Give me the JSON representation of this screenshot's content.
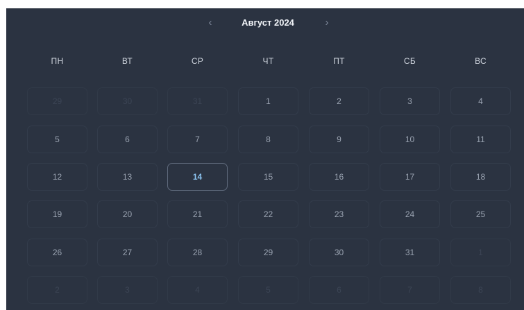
{
  "header": {
    "prev_icon": "‹",
    "next_icon": "›",
    "title": "Август 2024"
  },
  "weekdays": [
    "ПН",
    "ВТ",
    "СР",
    "ЧТ",
    "ПТ",
    "СБ",
    "ВС"
  ],
  "weeks": [
    [
      {
        "d": "29",
        "muted": true
      },
      {
        "d": "30",
        "muted": true
      },
      {
        "d": "31",
        "muted": true
      },
      {
        "d": "1"
      },
      {
        "d": "2"
      },
      {
        "d": "3"
      },
      {
        "d": "4"
      }
    ],
    [
      {
        "d": "5"
      },
      {
        "d": "6"
      },
      {
        "d": "7"
      },
      {
        "d": "8"
      },
      {
        "d": "9"
      },
      {
        "d": "10"
      },
      {
        "d": "11"
      }
    ],
    [
      {
        "d": "12"
      },
      {
        "d": "13"
      },
      {
        "d": "14",
        "today": true
      },
      {
        "d": "15"
      },
      {
        "d": "16"
      },
      {
        "d": "17"
      },
      {
        "d": "18"
      }
    ],
    [
      {
        "d": "19"
      },
      {
        "d": "20"
      },
      {
        "d": "21"
      },
      {
        "d": "22"
      },
      {
        "d": "23"
      },
      {
        "d": "24"
      },
      {
        "d": "25"
      }
    ],
    [
      {
        "d": "26"
      },
      {
        "d": "27"
      },
      {
        "d": "28"
      },
      {
        "d": "29"
      },
      {
        "d": "30"
      },
      {
        "d": "31"
      },
      {
        "d": "1",
        "muted": true
      }
    ],
    [
      {
        "d": "2",
        "muted": true
      },
      {
        "d": "3",
        "muted": true
      },
      {
        "d": "4",
        "muted": true
      },
      {
        "d": "5",
        "muted": true
      },
      {
        "d": "6",
        "muted": true
      },
      {
        "d": "7",
        "muted": true
      },
      {
        "d": "8",
        "muted": true
      }
    ]
  ],
  "colors": {
    "background": "#2b3341",
    "today_text": "#8cc4f0",
    "today_border": "#5f6a7c"
  }
}
